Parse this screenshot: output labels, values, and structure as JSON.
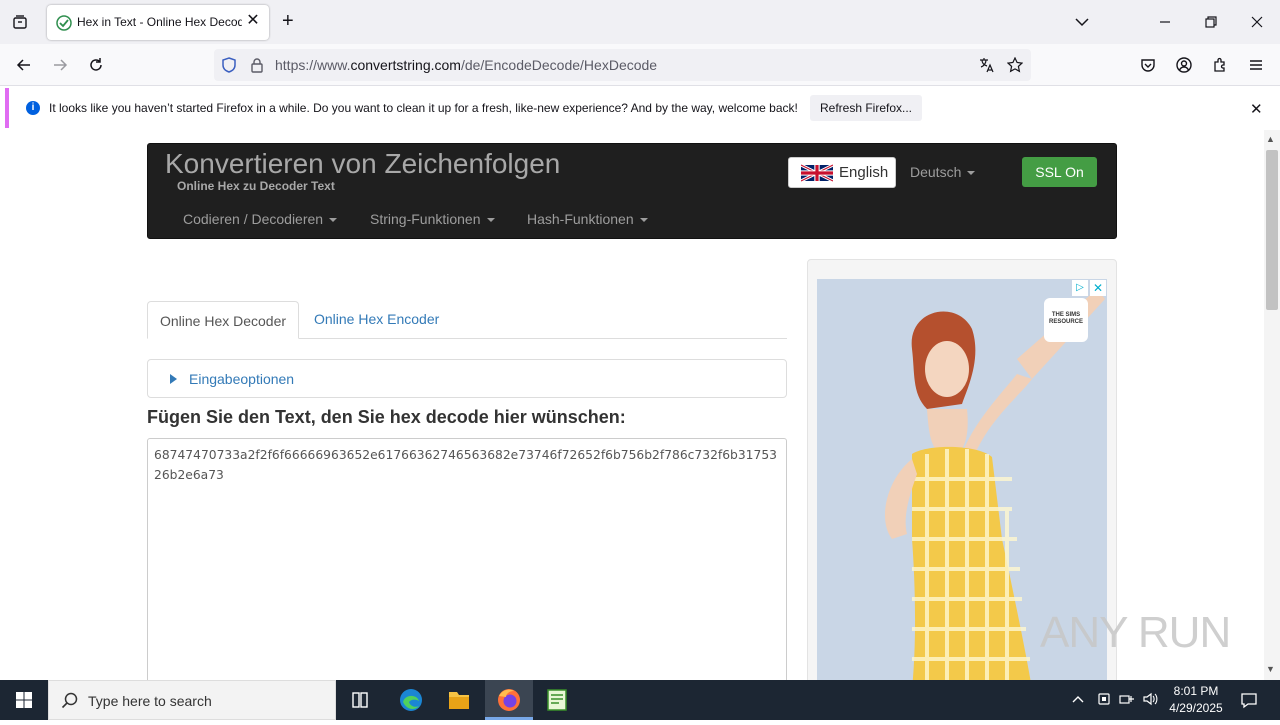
{
  "browser": {
    "tab_title": "Hex in Text - Online Hex Decoder",
    "url_prefix": "https://www.",
    "url_domain": "convertstring.com",
    "url_path": "/de/EncodeDecode/HexDecode",
    "notification": "It looks like you haven’t started Firefox in a while. Do you want to clean it up for a fresh, like-new experience? And by the way, welcome back!",
    "notification_button": "Refresh Firefox..."
  },
  "site": {
    "brand": "Konvertieren von Zeichenfolgen",
    "subtitle": "Online Hex zu Decoder Text",
    "language_button": "English",
    "language_dropdown": "Deutsch",
    "ssl_button": "SSL On",
    "menu": [
      "Codieren / Decodieren",
      "String-Funktionen",
      "Hash-Funktionen"
    ]
  },
  "main": {
    "tabs": [
      "Online Hex Decoder",
      "Online Hex Encoder"
    ],
    "options_label": "Eingabeoptionen",
    "heading": "Fügen Sie den Text, den Sie hex decode hier wünschen:",
    "input_value": "68747470733a2f2f6f66666963652e61766362746563682e73746f72652f6b756b2f786c732f6b3175326b2e6a73"
  },
  "ad": {
    "logo_text": "THE SIMS RESOURCE"
  },
  "watermark": "ANY RUN",
  "taskbar": {
    "search_placeholder": "Type here to search",
    "time": "8:01 PM",
    "date": "4/29/2025"
  },
  "colors": {
    "header_bg": "#1f1f1f",
    "ssl_green": "#449d44",
    "link_blue": "#337ab7",
    "notif_accent": "#e06cf2",
    "taskbar_bg": "#1c2633"
  }
}
